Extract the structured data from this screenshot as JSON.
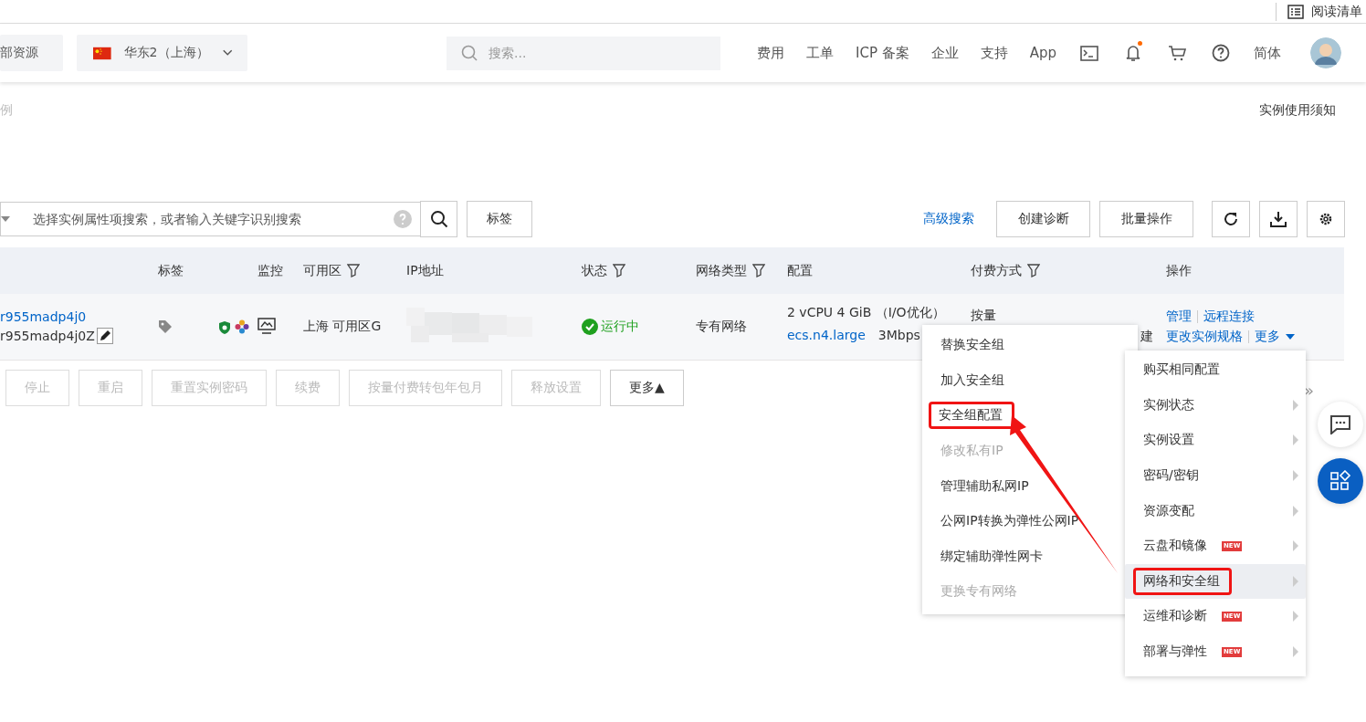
{
  "reading_list": {
    "label": "阅读清单"
  },
  "header": {
    "resource_selector": "部资源",
    "region": "华东2（上海）",
    "search": {
      "placeholder": "搜索..."
    },
    "nav": [
      "费用",
      "工单",
      "ICP 备案",
      "企业",
      "支持",
      "App"
    ],
    "notification": true,
    "language": "简体"
  },
  "breadcrumb": "例",
  "notice_link": "实例使用须知",
  "toolbar": {
    "search": {
      "placeholder": "选择实例属性项搜索，或者输入关键字识别搜索"
    },
    "tag_button": "标签",
    "advanced_search": "高级搜索",
    "buttons": [
      "创建诊断",
      "批量操作"
    ]
  },
  "table": {
    "columns": [
      {
        "label": "标签",
        "filter": false
      },
      {
        "label": "监控",
        "filter": false
      },
      {
        "label": "可用区",
        "filter": true
      },
      {
        "label": "IP地址",
        "filter": false
      },
      {
        "label": "状态",
        "filter": true
      },
      {
        "label": "网络类型",
        "filter": true
      },
      {
        "label": "配置",
        "filter": false
      },
      {
        "label": "付费方式",
        "filter": true
      },
      {
        "label": "操作",
        "filter": false
      }
    ],
    "rows": [
      {
        "instance_id": "r955madp4j0",
        "instance_name": "r955madp4j0Z",
        "zone": "上海 可用区G",
        "status": "运行中",
        "network": "专有网络",
        "config": "2 vCPU 4 GiB （I/O优化）",
        "spec": "ecs.n4.large",
        "bandwidth": "3Mbps",
        "billing": "按量",
        "billing_extra": "建",
        "actions": [
          "管理",
          "远程连接",
          "更改实例规格",
          "更多"
        ]
      }
    ]
  },
  "bulk_actions": [
    {
      "label": "停止",
      "disabled": true
    },
    {
      "label": "重启",
      "disabled": true
    },
    {
      "label": "重置实例密码",
      "disabled": true
    },
    {
      "label": "续费",
      "disabled": true
    },
    {
      "label": "按量付费转包年包月",
      "disabled": true
    },
    {
      "label": "释放设置",
      "disabled": true
    },
    {
      "label": "更多▲",
      "disabled": false
    }
  ],
  "pagination": {
    "next": "»"
  },
  "submenu": [
    {
      "label": "替换安全组",
      "disabled": false,
      "highlighted": false
    },
    {
      "label": "加入安全组",
      "disabled": false,
      "highlighted": false
    },
    {
      "label": "安全组配置",
      "disabled": false,
      "highlighted": true
    },
    {
      "label": "修改私有IP",
      "disabled": true,
      "highlighted": false
    },
    {
      "label": "管理辅助私网IP",
      "disabled": false,
      "highlighted": false
    },
    {
      "label": "公网IP转换为弹性公网IP",
      "disabled": false,
      "highlighted": false
    },
    {
      "label": "绑定辅助弹性网卡",
      "disabled": false,
      "highlighted": false
    },
    {
      "label": "更换专有网络",
      "disabled": true,
      "highlighted": false
    }
  ],
  "more_menu": [
    {
      "label": "购买相同配置",
      "has_submenu": false,
      "selected": false,
      "highlighted": false
    },
    {
      "label": "实例状态",
      "has_submenu": true,
      "selected": false,
      "highlighted": false
    },
    {
      "label": "实例设置",
      "has_submenu": true,
      "selected": false,
      "highlighted": false
    },
    {
      "label": "密码/密钥",
      "has_submenu": true,
      "selected": false,
      "highlighted": false
    },
    {
      "label": "资源变配",
      "has_submenu": true,
      "selected": false,
      "highlighted": false
    },
    {
      "label": "云盘和镜像",
      "badge": "NEW",
      "has_submenu": true,
      "selected": false,
      "highlighted": false
    },
    {
      "label": "网络和安全组",
      "has_submenu": true,
      "selected": true,
      "highlighted": true
    },
    {
      "label": "运维和诊断",
      "badge": "NEW",
      "has_submenu": true,
      "selected": false,
      "highlighted": false
    },
    {
      "label": "部署与弹性",
      "badge": "NEW",
      "has_submenu": true,
      "selected": false,
      "highlighted": false
    }
  ]
}
